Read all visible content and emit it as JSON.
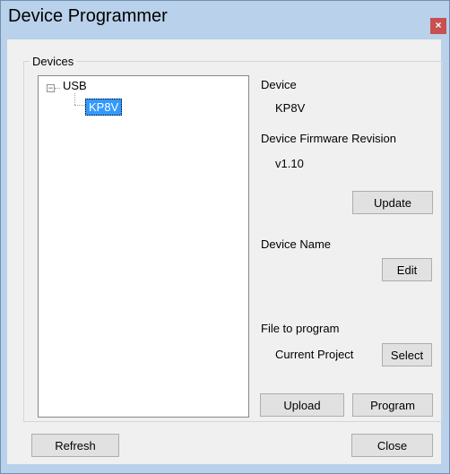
{
  "window": {
    "title": "Device Programmer",
    "close_glyph": "×"
  },
  "devices_group": {
    "label": "Devices",
    "tree": {
      "root": {
        "label": "USB",
        "expander": "−"
      },
      "children": [
        {
          "label": "KP8V",
          "selected": true
        }
      ]
    }
  },
  "details": {
    "device_label": "Device",
    "device_value": "KP8V",
    "firmware_label": "Device Firmware Revision",
    "firmware_value": "v1.10",
    "update_button": "Update",
    "device_name_label": "Device Name",
    "edit_button": "Edit",
    "file_label": "File to program",
    "file_value": "Current Project",
    "select_button": "Select",
    "upload_button": "Upload",
    "program_button": "Program"
  },
  "footer": {
    "refresh_button": "Refresh",
    "close_button": "Close"
  },
  "colors": {
    "title_bar": "#b9d1ea",
    "client_bg": "#f0f0f0",
    "selection": "#3399ff",
    "close_button": "#c75050"
  }
}
